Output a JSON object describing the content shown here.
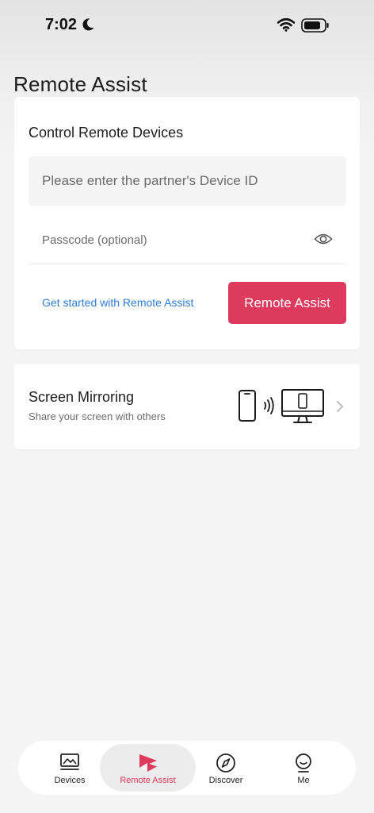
{
  "status_bar": {
    "time": "7:02"
  },
  "header": {
    "title": "Remote Assist"
  },
  "control_card": {
    "title": "Control Remote Devices",
    "device_id_placeholder": "Please enter the partner's Device ID",
    "passcode_placeholder": "Passcode (optional)",
    "help_link": "Get started with Remote Assist",
    "action_button": "Remote Assist"
  },
  "mirroring_card": {
    "title": "Screen Mirroring",
    "subtitle": "Share your screen with others"
  },
  "tab_bar": {
    "tabs": [
      {
        "label": "Devices",
        "icon": "devices-icon",
        "active": false
      },
      {
        "label": "Remote Assist",
        "icon": "remote-assist-icon",
        "active": true
      },
      {
        "label": "Discover",
        "icon": "compass-icon",
        "active": false
      },
      {
        "label": "Me",
        "icon": "profile-icon",
        "active": false
      }
    ]
  },
  "colors": {
    "accent": "#de3a5e",
    "link": "#2f7ddb",
    "background": "#f4f4f4"
  }
}
